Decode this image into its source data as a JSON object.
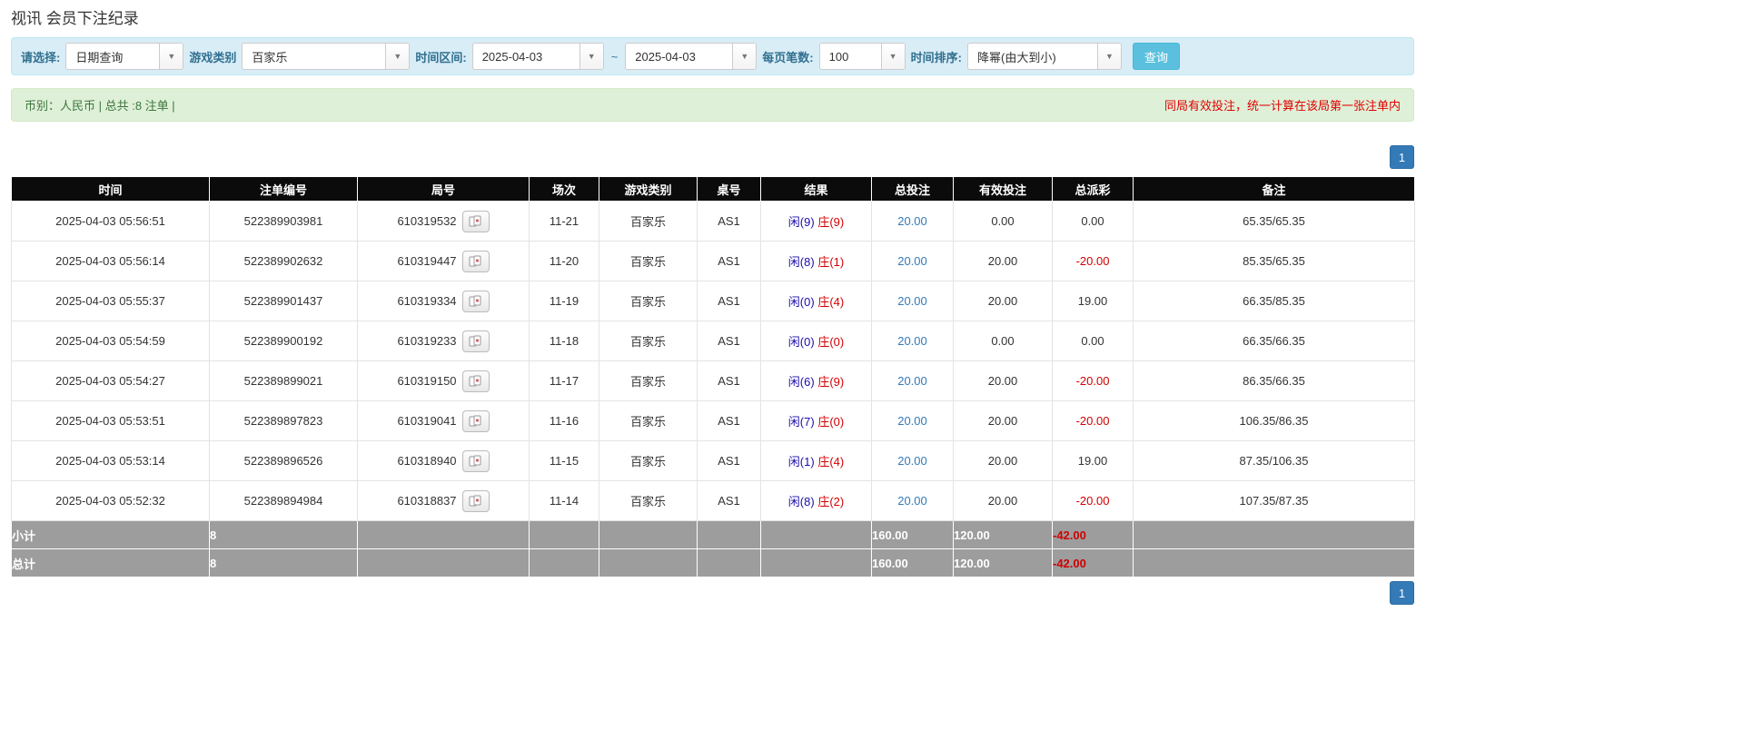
{
  "page": {
    "title": "视讯 会员下注纪录"
  },
  "filters": {
    "select_label": "请选择:",
    "select_value": "日期查询",
    "game_type_label": "游戏类别",
    "game_type_value": "百家乐",
    "time_range_label": "时间区间:",
    "date_from": "2025-04-03",
    "tilde": "~",
    "date_to": "2025-04-03",
    "page_size_label": "每页笔数:",
    "page_size_value": "100",
    "sort_label": "时间排序:",
    "sort_value": "降幂(由大到小)",
    "search_button": "查询"
  },
  "summary": {
    "left": "币别：人民币 | 总共 :8 注单 |",
    "right": "同局有效投注，统一计算在该局第一张注单内"
  },
  "pagination": {
    "page": "1"
  },
  "table": {
    "headers": [
      "时间",
      "注单编号",
      "局号",
      "场次",
      "游戏类别",
      "桌号",
      "结果",
      "总投注",
      "有效投注",
      "总派彩",
      "备注"
    ],
    "rows": [
      {
        "time": "2025-04-03 05:56:51",
        "bet_id": "522389903981",
        "round_id": "610319532",
        "session": "11-21",
        "game": "百家乐",
        "table_no": "AS1",
        "player": "闲(9)",
        "banker": "庄(9)",
        "total_bet": "20.00",
        "valid_bet": "0.00",
        "payout": "0.00",
        "remark": "65.35/65.35"
      },
      {
        "time": "2025-04-03 05:56:14",
        "bet_id": "522389902632",
        "round_id": "610319447",
        "session": "11-20",
        "game": "百家乐",
        "table_no": "AS1",
        "player": "闲(8)",
        "banker": "庄(1)",
        "total_bet": "20.00",
        "valid_bet": "20.00",
        "payout": "-20.00",
        "remark": "85.35/65.35"
      },
      {
        "time": "2025-04-03 05:55:37",
        "bet_id": "522389901437",
        "round_id": "610319334",
        "session": "11-19",
        "game": "百家乐",
        "table_no": "AS1",
        "player": "闲(0)",
        "banker": "庄(4)",
        "total_bet": "20.00",
        "valid_bet": "20.00",
        "payout": "19.00",
        "remark": "66.35/85.35"
      },
      {
        "time": "2025-04-03 05:54:59",
        "bet_id": "522389900192",
        "round_id": "610319233",
        "session": "11-18",
        "game": "百家乐",
        "table_no": "AS1",
        "player": "闲(0)",
        "banker": "庄(0)",
        "total_bet": "20.00",
        "valid_bet": "0.00",
        "payout": "0.00",
        "remark": "66.35/66.35"
      },
      {
        "time": "2025-04-03 05:54:27",
        "bet_id": "522389899021",
        "round_id": "610319150",
        "session": "11-17",
        "game": "百家乐",
        "table_no": "AS1",
        "player": "闲(6)",
        "banker": "庄(9)",
        "total_bet": "20.00",
        "valid_bet": "20.00",
        "payout": "-20.00",
        "remark": "86.35/66.35"
      },
      {
        "time": "2025-04-03 05:53:51",
        "bet_id": "522389897823",
        "round_id": "610319041",
        "session": "11-16",
        "game": "百家乐",
        "table_no": "AS1",
        "player": "闲(7)",
        "banker": "庄(0)",
        "total_bet": "20.00",
        "valid_bet": "20.00",
        "payout": "-20.00",
        "remark": "106.35/86.35"
      },
      {
        "time": "2025-04-03 05:53:14",
        "bet_id": "522389896526",
        "round_id": "610318940",
        "session": "11-15",
        "game": "百家乐",
        "table_no": "AS1",
        "player": "闲(1)",
        "banker": "庄(4)",
        "total_bet": "20.00",
        "valid_bet": "20.00",
        "payout": "19.00",
        "remark": "87.35/106.35"
      },
      {
        "time": "2025-04-03 05:52:32",
        "bet_id": "522389894984",
        "round_id": "610318837",
        "session": "11-14",
        "game": "百家乐",
        "table_no": "AS1",
        "player": "闲(8)",
        "banker": "庄(2)",
        "total_bet": "20.00",
        "valid_bet": "20.00",
        "payout": "-20.00",
        "remark": "107.35/87.35"
      }
    ],
    "subtotal": {
      "label": "小计",
      "count": "8",
      "total_bet": "160.00",
      "valid_bet": "120.00",
      "payout": "-42.00"
    },
    "total": {
      "label": "总计",
      "count": "8",
      "total_bet": "160.00",
      "valid_bet": "120.00",
      "payout": "-42.00"
    }
  }
}
